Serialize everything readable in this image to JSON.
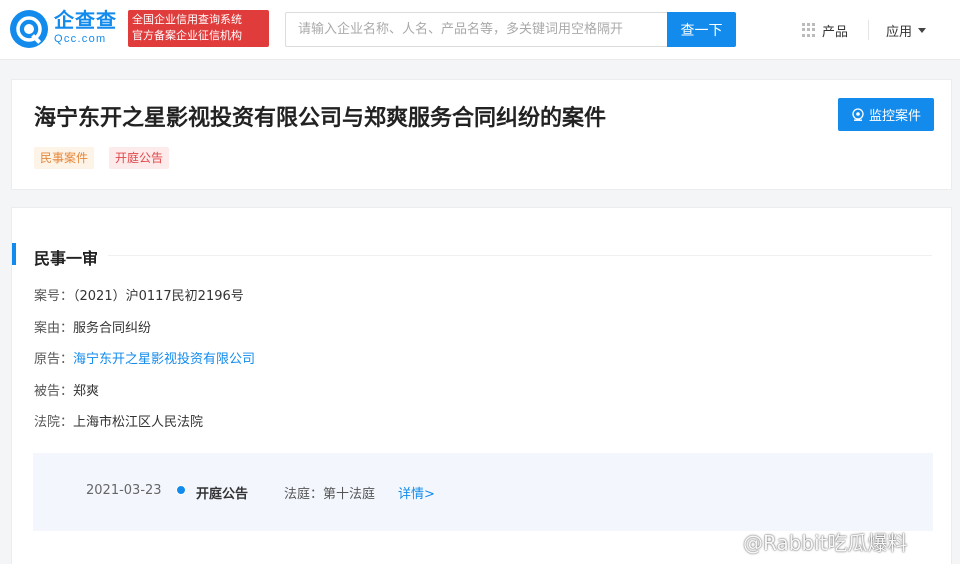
{
  "header": {
    "brand_name": "企查查",
    "brand_domain": "Qcc.com",
    "badge_line1": "全国企业信用查询系统",
    "badge_line2": "官方备案企业征信机构",
    "search_placeholder": "请输入企业名称、人名、产品名等，多关键词用空格隔开",
    "search_button": "查一下",
    "nav_products": "产品",
    "nav_apps": "应用"
  },
  "case": {
    "title": "海宁东开之星影视投资有限公司与郑爽服务合同纠纷的案件",
    "tags": [
      "民事案件",
      "开庭公告"
    ],
    "monitor_button": "监控案件"
  },
  "detail": {
    "section_title": "民事一审",
    "rows": [
      {
        "label": "案号：",
        "value": "（2021）沪0117民初2196号"
      },
      {
        "label": "案由：",
        "value": "服务合同纠纷"
      },
      {
        "label": "原告：",
        "value": "海宁东开之星影视投资有限公司"
      },
      {
        "label": "被告：",
        "value": "郑爽"
      },
      {
        "label": "法院：",
        "value": "上海市松江区人民法院"
      }
    ],
    "timeline": {
      "date": "2021-03-23",
      "type": "开庭公告",
      "court_label": "法庭：",
      "court_value": "第十法庭",
      "detail_link": "详情>"
    }
  },
  "watermark": "@Rabbit吃瓜爆料",
  "colors": {
    "accent": "#128bed",
    "badge_red": "#e03c3c",
    "tag_orange": "#e5883c",
    "tag_red": "#e0484b"
  }
}
